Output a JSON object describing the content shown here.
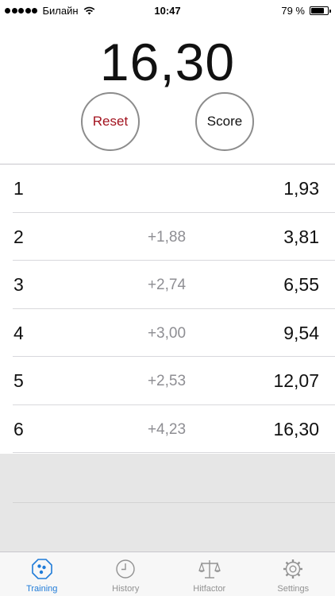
{
  "status_bar": {
    "carrier": "Билайн",
    "time": "10:47",
    "battery_percent": "79 %",
    "battery_level": 0.79,
    "signal_bars": 5,
    "signal_filled": 5
  },
  "timer": {
    "value": "16,30"
  },
  "buttons": {
    "reset_label": "Reset",
    "score_label": "Score",
    "reset_color": "#a2121e"
  },
  "shots": [
    {
      "index": "1",
      "split": "",
      "total": "1,93"
    },
    {
      "index": "2",
      "split": "+1,88",
      "total": "3,81"
    },
    {
      "index": "3",
      "split": "+2,74",
      "total": "6,55"
    },
    {
      "index": "4",
      "split": "+3,00",
      "total": "9,54"
    },
    {
      "index": "5",
      "split": "+2,53",
      "total": "12,07"
    },
    {
      "index": "6",
      "split": "+4,23",
      "total": "16,30"
    }
  ],
  "tab_bar": {
    "active_color": "#1f7bd8",
    "inactive_color": "#929292",
    "tabs": [
      {
        "label": "Training",
        "icon": "target-icon",
        "active": true
      },
      {
        "label": "History",
        "icon": "clock-icon",
        "active": false
      },
      {
        "label": "Hitfactor",
        "icon": "scales-icon",
        "active": false
      },
      {
        "label": "Settings",
        "icon": "gear-icon",
        "active": false
      }
    ]
  }
}
